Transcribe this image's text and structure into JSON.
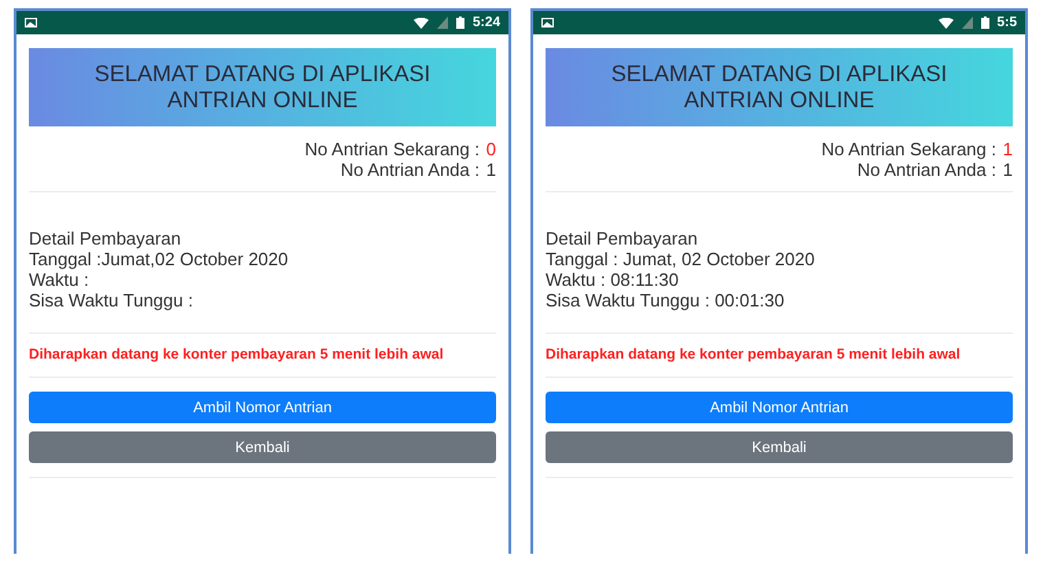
{
  "phones": [
    {
      "status_time": "5:24",
      "title_lines": [
        "SELAMAT DATANG DI APLIKASI",
        "ANTRIAN ONLINE"
      ],
      "current_label": "No Antrian Sekarang :",
      "current_value": "0",
      "yours_label": "No Antrian Anda :",
      "yours_value": "1",
      "detail_title": "Detail Pembayaran",
      "detail_lines": [
        "Tanggal :Jumat,02 October 2020",
        "Waktu :",
        "Sisa Waktu Tunggu :"
      ],
      "notice": "Diharapkan datang ke konter pembayaran 5 menit lebih awal",
      "buttons": [
        {
          "label": "Ambil Nomor Antrian",
          "kind": "primary"
        },
        {
          "label": "Kembali",
          "kind": "secondary"
        }
      ]
    },
    {
      "status_time": "5:5",
      "title_lines": [
        "SELAMAT DATANG DI APLIKASI",
        "ANTRIAN ONLINE"
      ],
      "current_label": "No Antrian Sekarang :",
      "current_value": "1",
      "yours_label": "No Antrian Anda :",
      "yours_value": "1",
      "detail_title": "Detail Pembayaran",
      "detail_lines": [
        "Tanggal : Jumat, 02 October 2020",
        "Waktu : 08:11:30",
        "Sisa Waktu Tunggu : 00:01:30"
      ],
      "notice": "Diharapkan datang ke konter pembayaran 5 menit lebih awal",
      "buttons": [
        {
          "label": "Ambil Nomor Antrian",
          "kind": "primary"
        },
        {
          "label": "Kembali",
          "kind": "secondary"
        }
      ]
    }
  ]
}
